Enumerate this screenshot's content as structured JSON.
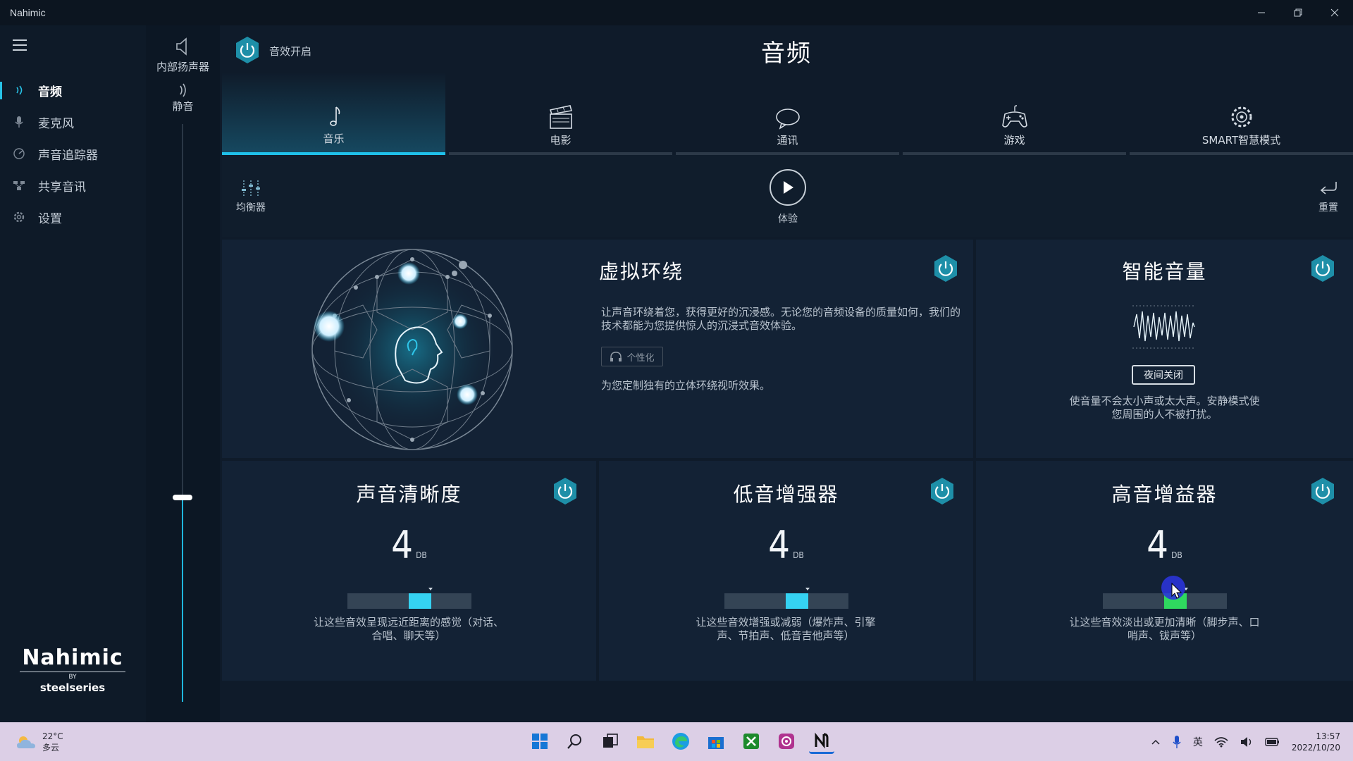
{
  "window": {
    "title": "Nahimic"
  },
  "sidebar": {
    "items": [
      {
        "label": "音频",
        "icon": "audio-wave-icon",
        "active": true
      },
      {
        "label": "麦克风",
        "icon": "microphone-icon",
        "active": false
      },
      {
        "label": "声音追踪器",
        "icon": "sound-tracker-icon",
        "active": false
      },
      {
        "label": "共享音讯",
        "icon": "share-audio-icon",
        "active": false
      },
      {
        "label": "设置",
        "icon": "gear-icon",
        "active": false
      }
    ],
    "brand": {
      "logo": "Nahimic",
      "by": "BY",
      "maker": "steelseries"
    }
  },
  "volume": {
    "device_label": "内部扬声器",
    "mute_label": "静音",
    "level": 0.35
  },
  "header": {
    "power_label": "音效开启",
    "title": "音频"
  },
  "tabs": [
    {
      "label": "音乐",
      "icon": "music-note-icon",
      "active": true
    },
    {
      "label": "电影",
      "icon": "clapperboard-icon",
      "active": false
    },
    {
      "label": "通讯",
      "icon": "chat-bubble-icon",
      "active": false
    },
    {
      "label": "游戏",
      "icon": "gamepad-icon",
      "active": false
    },
    {
      "label": "SMART智慧模式",
      "icon": "smart-gear-icon",
      "active": false
    }
  ],
  "toolbar": {
    "equalizer_label": "均衡器",
    "play_label": "体验",
    "reset_label": "重置"
  },
  "panels": {
    "surround": {
      "title": "虚拟环绕",
      "description": "让声音环绕着您，获得更好的沉浸感。无论您的音频设备的质量如何，我们的技术都能为您提供惊人的沉浸式音效体验。",
      "personalize_label": "个性化",
      "personalize_desc": "为您定制独有的立体环绕视听效果。"
    },
    "smart_volume": {
      "title": "智能音量",
      "night_button": "夜间关闭",
      "description": "使音量不会太小声或太大声。安静模式使您周围的人不被打扰。"
    },
    "clarity": {
      "title": "声音清晰度",
      "value": "4",
      "unit": "DB",
      "description": "让这些音效呈现远近距离的感觉（对话、合唱、聊天等）"
    },
    "bass": {
      "title": "低音增强器",
      "value": "4",
      "unit": "DB",
      "description": "让这些音效增强或减弱（爆炸声、引擎声、节拍声、低音吉他声等）"
    },
    "treble": {
      "title": "高音增益器",
      "value": "4",
      "unit": "DB",
      "description": "让这些音效淡出或更加清晰（脚步声、口哨声、钹声等）"
    }
  },
  "taskbar": {
    "weather_temp": "22°C",
    "weather_desc": "多云",
    "input_method": "英",
    "time": "13:57",
    "date": "2022/10/20"
  }
}
